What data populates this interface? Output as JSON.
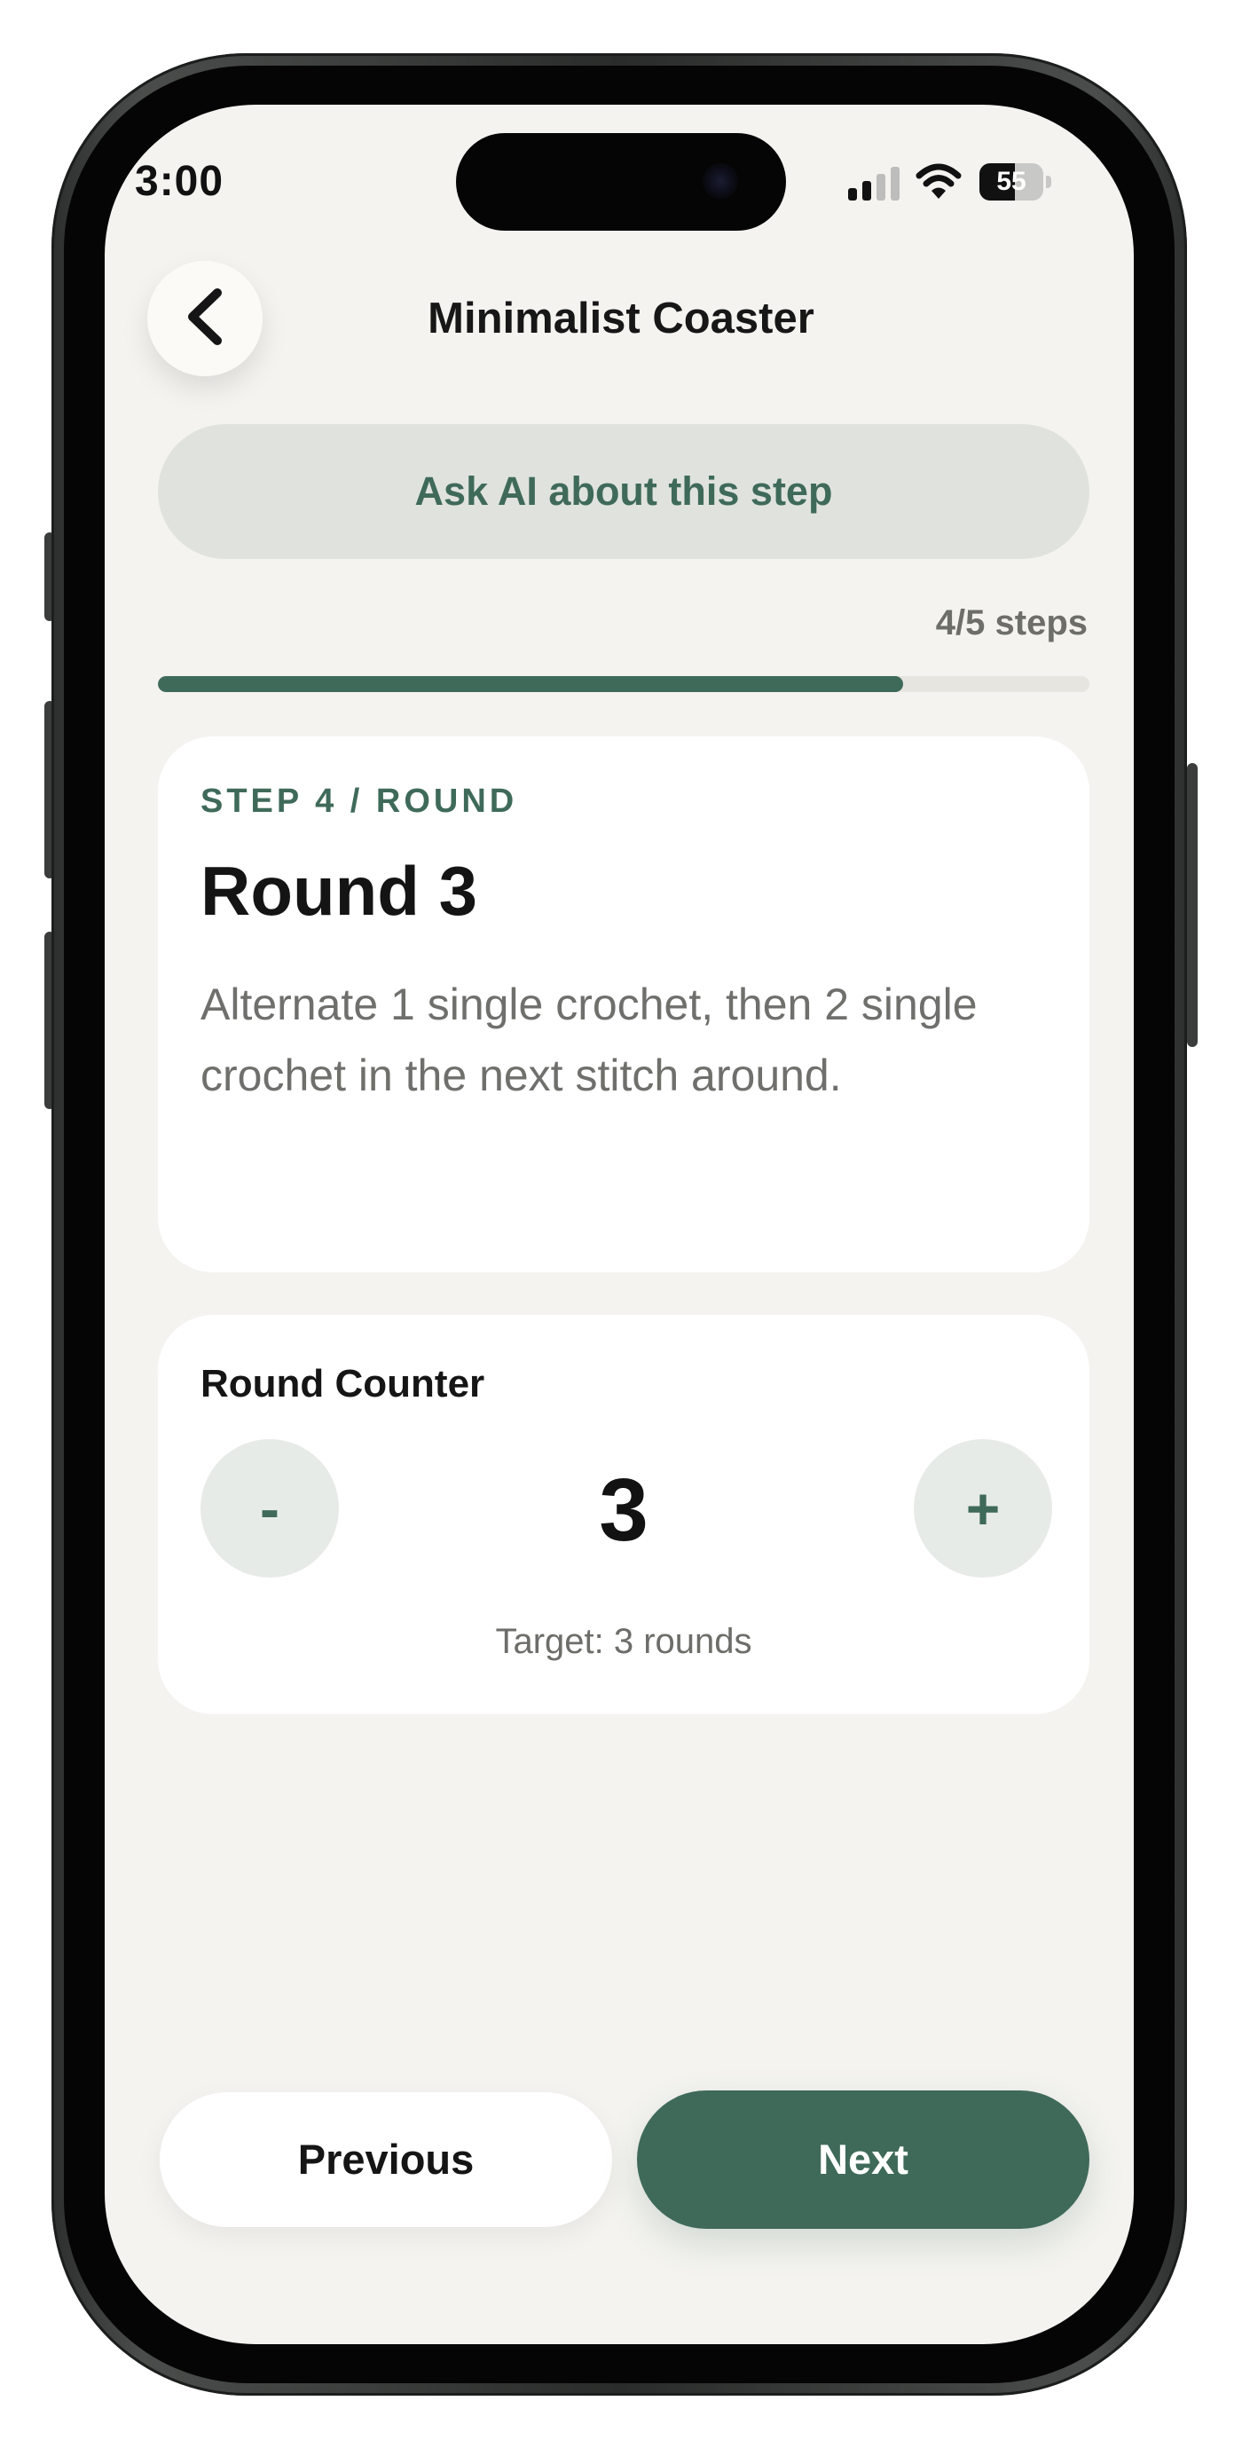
{
  "status_bar": {
    "time": "3:00",
    "battery_level": "55",
    "battery_percent": 55,
    "signal_bars_active": 2,
    "signal_icon": "cellular-signal-icon",
    "wifi_icon": "wifi-icon",
    "battery_icon": "battery-icon"
  },
  "header": {
    "back_icon": "chevron-left-icon",
    "title": "Minimalist Coaster"
  },
  "ask_ai": {
    "label": "Ask AI about this step"
  },
  "progress": {
    "label": "4/5 steps",
    "current": 4,
    "total": 5,
    "fraction": 0.8
  },
  "step": {
    "label": "STEP 4 / ROUND",
    "title": "Round 3",
    "description": "Alternate 1 single crochet, then 2 single crochet in the next stitch around."
  },
  "counter": {
    "label": "Round Counter",
    "decrement_label": "-",
    "increment_label": "+",
    "value": "3",
    "target": "Target: 3 rounds"
  },
  "footer": {
    "previous_label": "Previous",
    "next_label": "Next"
  },
  "colors": {
    "accent": "#3f6a5a",
    "background": "#f4f3ef",
    "card": "#ffffff",
    "ai_button": "#e0e3dd",
    "counter_button": "#e7ebe8",
    "progress_track": "#e6e5e0"
  }
}
